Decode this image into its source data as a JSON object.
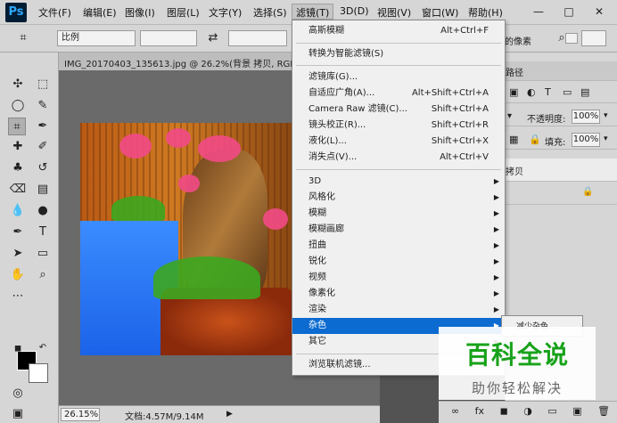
{
  "app": {
    "logo": "Ps",
    "menu": [
      "文件(F)",
      "编辑(E)",
      "图像(I)",
      "图层(L)",
      "文字(Y)",
      "选择(S)",
      "滤镜(T)",
      "3D(D)",
      "视图(V)",
      "窗口(W)",
      "帮助(H)"
    ],
    "active_menu": "滤镜(T)"
  },
  "options": {
    "ratio_label": "比例",
    "right_text": "的像素",
    "swap_icon": "swap-icon"
  },
  "document": {
    "tab_title": "IMG_20170403_135613.jpg @ 26.2%(背景 拷贝, RGB",
    "zoom": "26.15%",
    "doc_size": "文档:4.57M/9.14M"
  },
  "filter_menu": {
    "items": [
      {
        "label": "高斯模糊",
        "shortcut": "Alt+Ctrl+F",
        "arrow": ""
      },
      {
        "label": "转换为智能滤镜(S)",
        "shortcut": "",
        "arrow": ""
      },
      {
        "label": "滤镜库(G)...",
        "shortcut": "",
        "arrow": ""
      },
      {
        "label": "自适应广角(A)...",
        "shortcut": "Alt+Shift+Ctrl+A",
        "arrow": ""
      },
      {
        "label": "Camera Raw 滤镜(C)...",
        "shortcut": "Shift+Ctrl+A",
        "arrow": ""
      },
      {
        "label": "镜头校正(R)...",
        "shortcut": "Shift+Ctrl+R",
        "arrow": ""
      },
      {
        "label": "液化(L)...",
        "shortcut": "Shift+Ctrl+X",
        "arrow": ""
      },
      {
        "label": "消失点(V)...",
        "shortcut": "Alt+Ctrl+V",
        "arrow": ""
      },
      {
        "label": "3D",
        "shortcut": "",
        "arrow": "▶"
      },
      {
        "label": "风格化",
        "shortcut": "",
        "arrow": "▶"
      },
      {
        "label": "模糊",
        "shortcut": "",
        "arrow": "▶"
      },
      {
        "label": "模糊画廊",
        "shortcut": "",
        "arrow": "▶"
      },
      {
        "label": "扭曲",
        "shortcut": "",
        "arrow": "▶"
      },
      {
        "label": "锐化",
        "shortcut": "",
        "arrow": "▶"
      },
      {
        "label": "视频",
        "shortcut": "",
        "arrow": "▶"
      },
      {
        "label": "像素化",
        "shortcut": "",
        "arrow": "▶"
      },
      {
        "label": "渲染",
        "shortcut": "",
        "arrow": "▶"
      },
      {
        "label": "杂色",
        "shortcut": "",
        "arrow": "▶"
      },
      {
        "label": "其它",
        "shortcut": "",
        "arrow": "▶"
      },
      {
        "label": "浏览联机滤镜...",
        "shortcut": "",
        "arrow": ""
      }
    ],
    "highlighted": "杂色"
  },
  "submenu": {
    "visible_item": "减少杂色..."
  },
  "panels": {
    "tab_label": "路径",
    "opacity_label": "不透明度:",
    "opacity_value": "100%",
    "fill_label": "填充:",
    "fill_value": "100%",
    "layer_name": "拷贝"
  },
  "watermark": {
    "title": "百科全说",
    "subtitle": "助你轻松解决"
  },
  "colors": {
    "accent": "#0b6bd1",
    "toolbar_bg": "#d6d6d6",
    "workspace_bg": "#535353"
  }
}
